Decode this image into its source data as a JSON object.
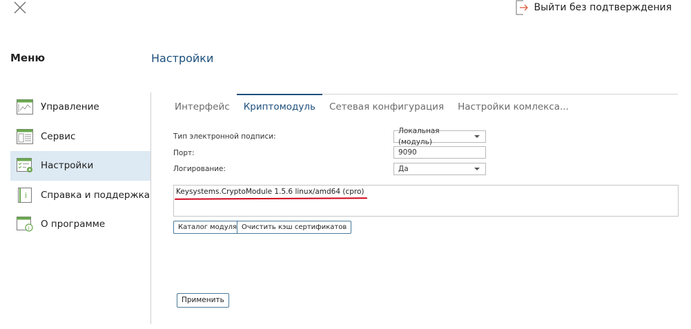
{
  "header": {
    "close_icon": "close-icon",
    "logout_label": "Выйти без подтверждения",
    "logout_icon": "logout-icon"
  },
  "menu_title": "Меню",
  "page_title": "Настройки",
  "sidebar": {
    "items": [
      {
        "label": "Управление",
        "icon": "dashboard-icon",
        "active": false
      },
      {
        "label": "Сервис",
        "icon": "service-icon",
        "active": false
      },
      {
        "label": "Настройки",
        "icon": "settings-icon",
        "active": true
      },
      {
        "label": "Справка и поддержка",
        "icon": "help-icon",
        "active": false
      },
      {
        "label": "О программе",
        "icon": "about-icon",
        "active": false
      }
    ]
  },
  "tabs": [
    {
      "label": "Интерфейс",
      "active": false
    },
    {
      "label": "Криптомодуль",
      "active": true
    },
    {
      "label": "Сетевая конфигурация",
      "active": false
    },
    {
      "label": "Настройки комлекса...",
      "active": false
    }
  ],
  "form": {
    "signature_type_label": "Тип электронной подписи:",
    "signature_type_value": "Локальная (модуль)",
    "port_label": "Порт:",
    "port_value": "9090",
    "logging_label": "Логирование:",
    "logging_value": "Да"
  },
  "module_info": "Keysystems.CryptoModule 1.5.6 linux/amd64 (cpro)",
  "buttons": {
    "module_catalog": "Каталог модуля",
    "clear_cache": "Очистить кэш сертификатов",
    "apply": "Применить"
  },
  "colors": {
    "accent": "#1d4f7c",
    "active_bg": "#dde9f3",
    "logout_arrow": "#e05a3a",
    "annotation": "#d0021b"
  }
}
